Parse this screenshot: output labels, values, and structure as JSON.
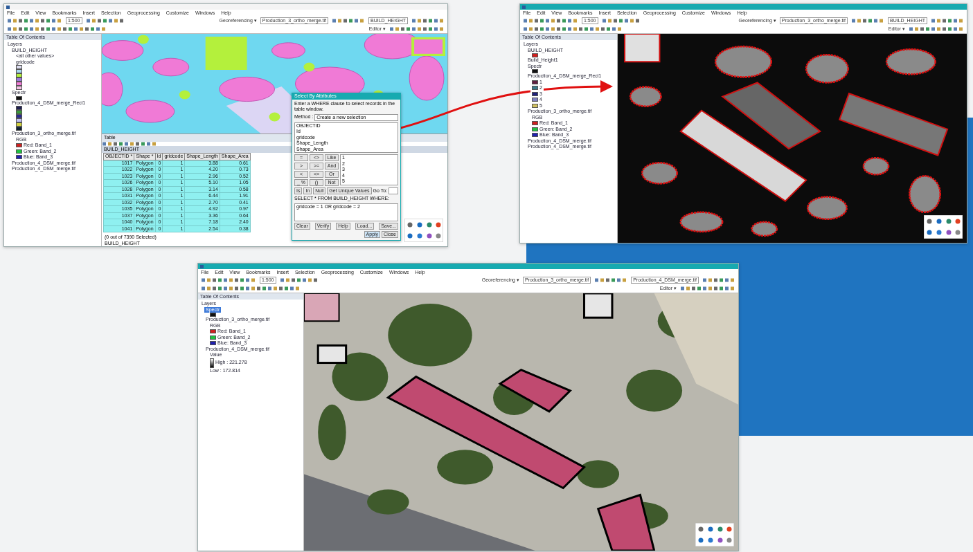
{
  "windows": [
    {
      "menu": [
        "File",
        "Edit",
        "View",
        "Bookmarks",
        "Insert",
        "Selection",
        "Geoprocessing",
        "Customize",
        "Windows",
        "Help"
      ],
      "scale": "1:500",
      "georef_label": "Georeferencing ▾",
      "georef_layer": "Production_3_ortho_merge.tif",
      "layer_select": "BUILD_HEIGHT",
      "editor": "Editor ▾",
      "toc": {
        "title": "Table Of Contents",
        "layers": [
          {
            "label": "Layers",
            "children": [
              {
                "label": "BUILD_HEIGHT",
                "children": [
                  {
                    "label": "<all other values>"
                  },
                  {
                    "label": "gridcode"
                  },
                  {
                    "color": "#dcdcf0"
                  },
                  {
                    "color": "#a8d8f0"
                  },
                  {
                    "color": "#b4f03c"
                  },
                  {
                    "color": "#9a7ad8"
                  },
                  {
                    "color": "#f07ad6"
                  },
                  {
                    "color": "#f4c0e4"
                  }
                ]
              },
              {
                "label": "Spectr",
                "children": [
                  {
                    "color": "#111111"
                  }
                ]
              },
              {
                "label": "Production_4_DSM_merge_Recl1",
                "children": [
                  {
                    "color": "#202050"
                  },
                  {
                    "color": "#3a9a3a"
                  },
                  {
                    "color": "#2a2a90"
                  },
                  {
                    "color": "#c0c0f0"
                  },
                  {
                    "color": "#d0d040"
                  },
                  {
                    "color": "#102030"
                  }
                ]
              },
              {
                "label": "Production_3_ortho_merge.tif",
                "children": [
                  {
                    "label": "RGB"
                  },
                  {
                    "label": "Red: Band_1",
                    "color": "#d02020"
                  },
                  {
                    "label": "Green: Band_2",
                    "color": "#20c040"
                  },
                  {
                    "label": "Blue: Band_3",
                    "color": "#2020b0"
                  }
                ]
              },
              {
                "label": "Production_4_DSM_merge.tif"
              },
              {
                "label": "Production_4_DSM_merge.tif"
              }
            ]
          }
        ]
      },
      "map": {
        "kind": "classified"
      },
      "table": {
        "title": "Table",
        "tab": "BUILD_HEIGHT",
        "columns": [
          "OBJECTID *",
          "Shape *",
          "Id",
          "gridcode",
          "Shape_Length",
          "Shape_Area"
        ],
        "rows": [
          [
            "1017",
            "Polygon",
            "0",
            "1",
            "3.88",
            "0.61"
          ],
          [
            "1022",
            "Polygon",
            "0",
            "1",
            "4.20",
            "0.73"
          ],
          [
            "1023",
            "Polygon",
            "0",
            "1",
            "2.96",
            "0.52"
          ],
          [
            "1026",
            "Polygon",
            "0",
            "1",
            "5.10",
            "1.05"
          ],
          [
            "1028",
            "Polygon",
            "0",
            "1",
            "3.14",
            "0.58"
          ],
          [
            "1031",
            "Polygon",
            "0",
            "1",
            "6.44",
            "1.91"
          ],
          [
            "1032",
            "Polygon",
            "0",
            "1",
            "2.70",
            "0.41"
          ],
          [
            "1035",
            "Polygon",
            "0",
            "1",
            "4.92",
            "0.97"
          ],
          [
            "1037",
            "Polygon",
            "0",
            "1",
            "3.36",
            "0.64"
          ],
          [
            "1040",
            "Polygon",
            "0",
            "1",
            "7.18",
            "2.40"
          ],
          [
            "1041",
            "Polygon",
            "0",
            "1",
            "2.54",
            "0.38"
          ]
        ],
        "status": "(0 out of 7390 Selected)",
        "footer_tab": "BUILD_HEIGHT"
      },
      "dialog": {
        "title": "Select By Attributes",
        "hint": "Enter a WHERE clause to select records in the table window.",
        "method_label": "Method :",
        "method": "Create a new selection",
        "fields": [
          "OBJECTID",
          "Id",
          "gridcode",
          "Shape_Length",
          "Shape_Area"
        ],
        "operators": [
          "=",
          "<>",
          "Like",
          ">",
          ">=",
          "And",
          "<",
          "<=",
          "Or",
          "_ %",
          "()",
          "Not"
        ],
        "extra_ops": [
          "Is",
          "In",
          "Null"
        ],
        "unique_button": "Get Unique Values",
        "goto_label": "Go To:",
        "values": [
          "1",
          "2",
          "3",
          "4",
          "5"
        ],
        "clause_label": "SELECT * FROM BUILD_HEIGHT WHERE:",
        "query": "gridcode = 1 OR gridcode = 2",
        "buttons": [
          "Clear",
          "Verify",
          "Help",
          "Load...",
          "Save..."
        ],
        "footer_buttons": [
          "Apply",
          "Close"
        ]
      }
    },
    {
      "menu": [
        "File",
        "Edit",
        "View",
        "Bookmarks",
        "Insert",
        "Selection",
        "Geoprocessing",
        "Customize",
        "Windows",
        "Help"
      ],
      "scale": "1:500",
      "georef_label": "Georeferencing ▾",
      "georef_layer": "Production_3_ortho_merge.tif",
      "layer_select": "BUILD_HEIGHT",
      "editor": "Editor ▾",
      "toc": {
        "title": "Table Of Contents",
        "layers": [
          {
            "label": "Layers",
            "children": [
              {
                "label": "BUILD_HEIGHT",
                "children": [
                  {
                    "color": "#d02020"
                  }
                ]
              },
              {
                "label": "Build_Height1"
              },
              {
                "label": "Spectr",
                "children": [
                  {
                    "color": "#111111"
                  }
                ]
              },
              {
                "label": "Production_4_DSM_merge_Recl1",
                "children": [
                  {
                    "label": "1",
                    "color": "#602040"
                  },
                  {
                    "label": "2",
                    "color": "#3a7a8a"
                  },
                  {
                    "label": "3",
                    "color": "#20207a"
                  },
                  {
                    "label": "4",
                    "color": "#8080c0"
                  },
                  {
                    "label": "5",
                    "color": "#d0c060"
                  }
                ]
              },
              {
                "label": "Production_3_ortho_merge.tif",
                "children": [
                  {
                    "label": "RGB"
                  },
                  {
                    "label": "Red: Band_1",
                    "color": "#d02020"
                  },
                  {
                    "label": "Green: Band_2",
                    "color": "#20c040"
                  },
                  {
                    "label": "Blue: Band_3",
                    "color": "#2020b0"
                  }
                ]
              },
              {
                "label": "Production_4_DSM_merge.tif"
              },
              {
                "label": "Production_4_DSM_merge.tif"
              }
            ]
          }
        ]
      },
      "map": {
        "kind": "elevation"
      }
    },
    {
      "menu": [
        "File",
        "Edit",
        "View",
        "Bookmarks",
        "Insert",
        "Selection",
        "Geoprocessing",
        "Customize",
        "Windows",
        "Help"
      ],
      "scale": "1:500",
      "georef_label": "Georeferencing ▾",
      "georef_layer": "Production_3_ortho_merge.tif",
      "layer_select": "Production_4_DSM_merge.tif",
      "editor": "Editor ▾",
      "toc": {
        "title": "Table Of Contents",
        "layers": [
          {
            "label": "Layers",
            "selected": false,
            "children": [
              {
                "label": "Spectr",
                "selected": true,
                "children": [
                  {
                    "color": "#111111",
                    "selected": false
                  }
                ]
              },
              {
                "label": "Production_3_ortho_merge.tif",
                "selected": false,
                "children": [
                  {
                    "label": "RGB",
                    "selected": false
                  },
                  {
                    "label": "Red: Band_1",
                    "color": "#d02020",
                    "selected": false
                  },
                  {
                    "label": "Green: Band_2",
                    "color": "#20c040",
                    "selected": false
                  },
                  {
                    "label": "Blue: Band_3",
                    "color": "#2020b0",
                    "selected": false
                  }
                ]
              },
              {
                "label": "Production_4_DSM_merge.tif",
                "selected": false,
                "children": [
                  {
                    "label": "Value",
                    "selected": false
                  },
                  {
                    "label": "High : 221.278",
                    "kind": "ramp",
                    "selected": false
                  },
                  {
                    "label": "Low : 172.814",
                    "selected": false
                  }
                ]
              }
            ]
          }
        ]
      },
      "map": {
        "kind": "aerial"
      }
    }
  ]
}
